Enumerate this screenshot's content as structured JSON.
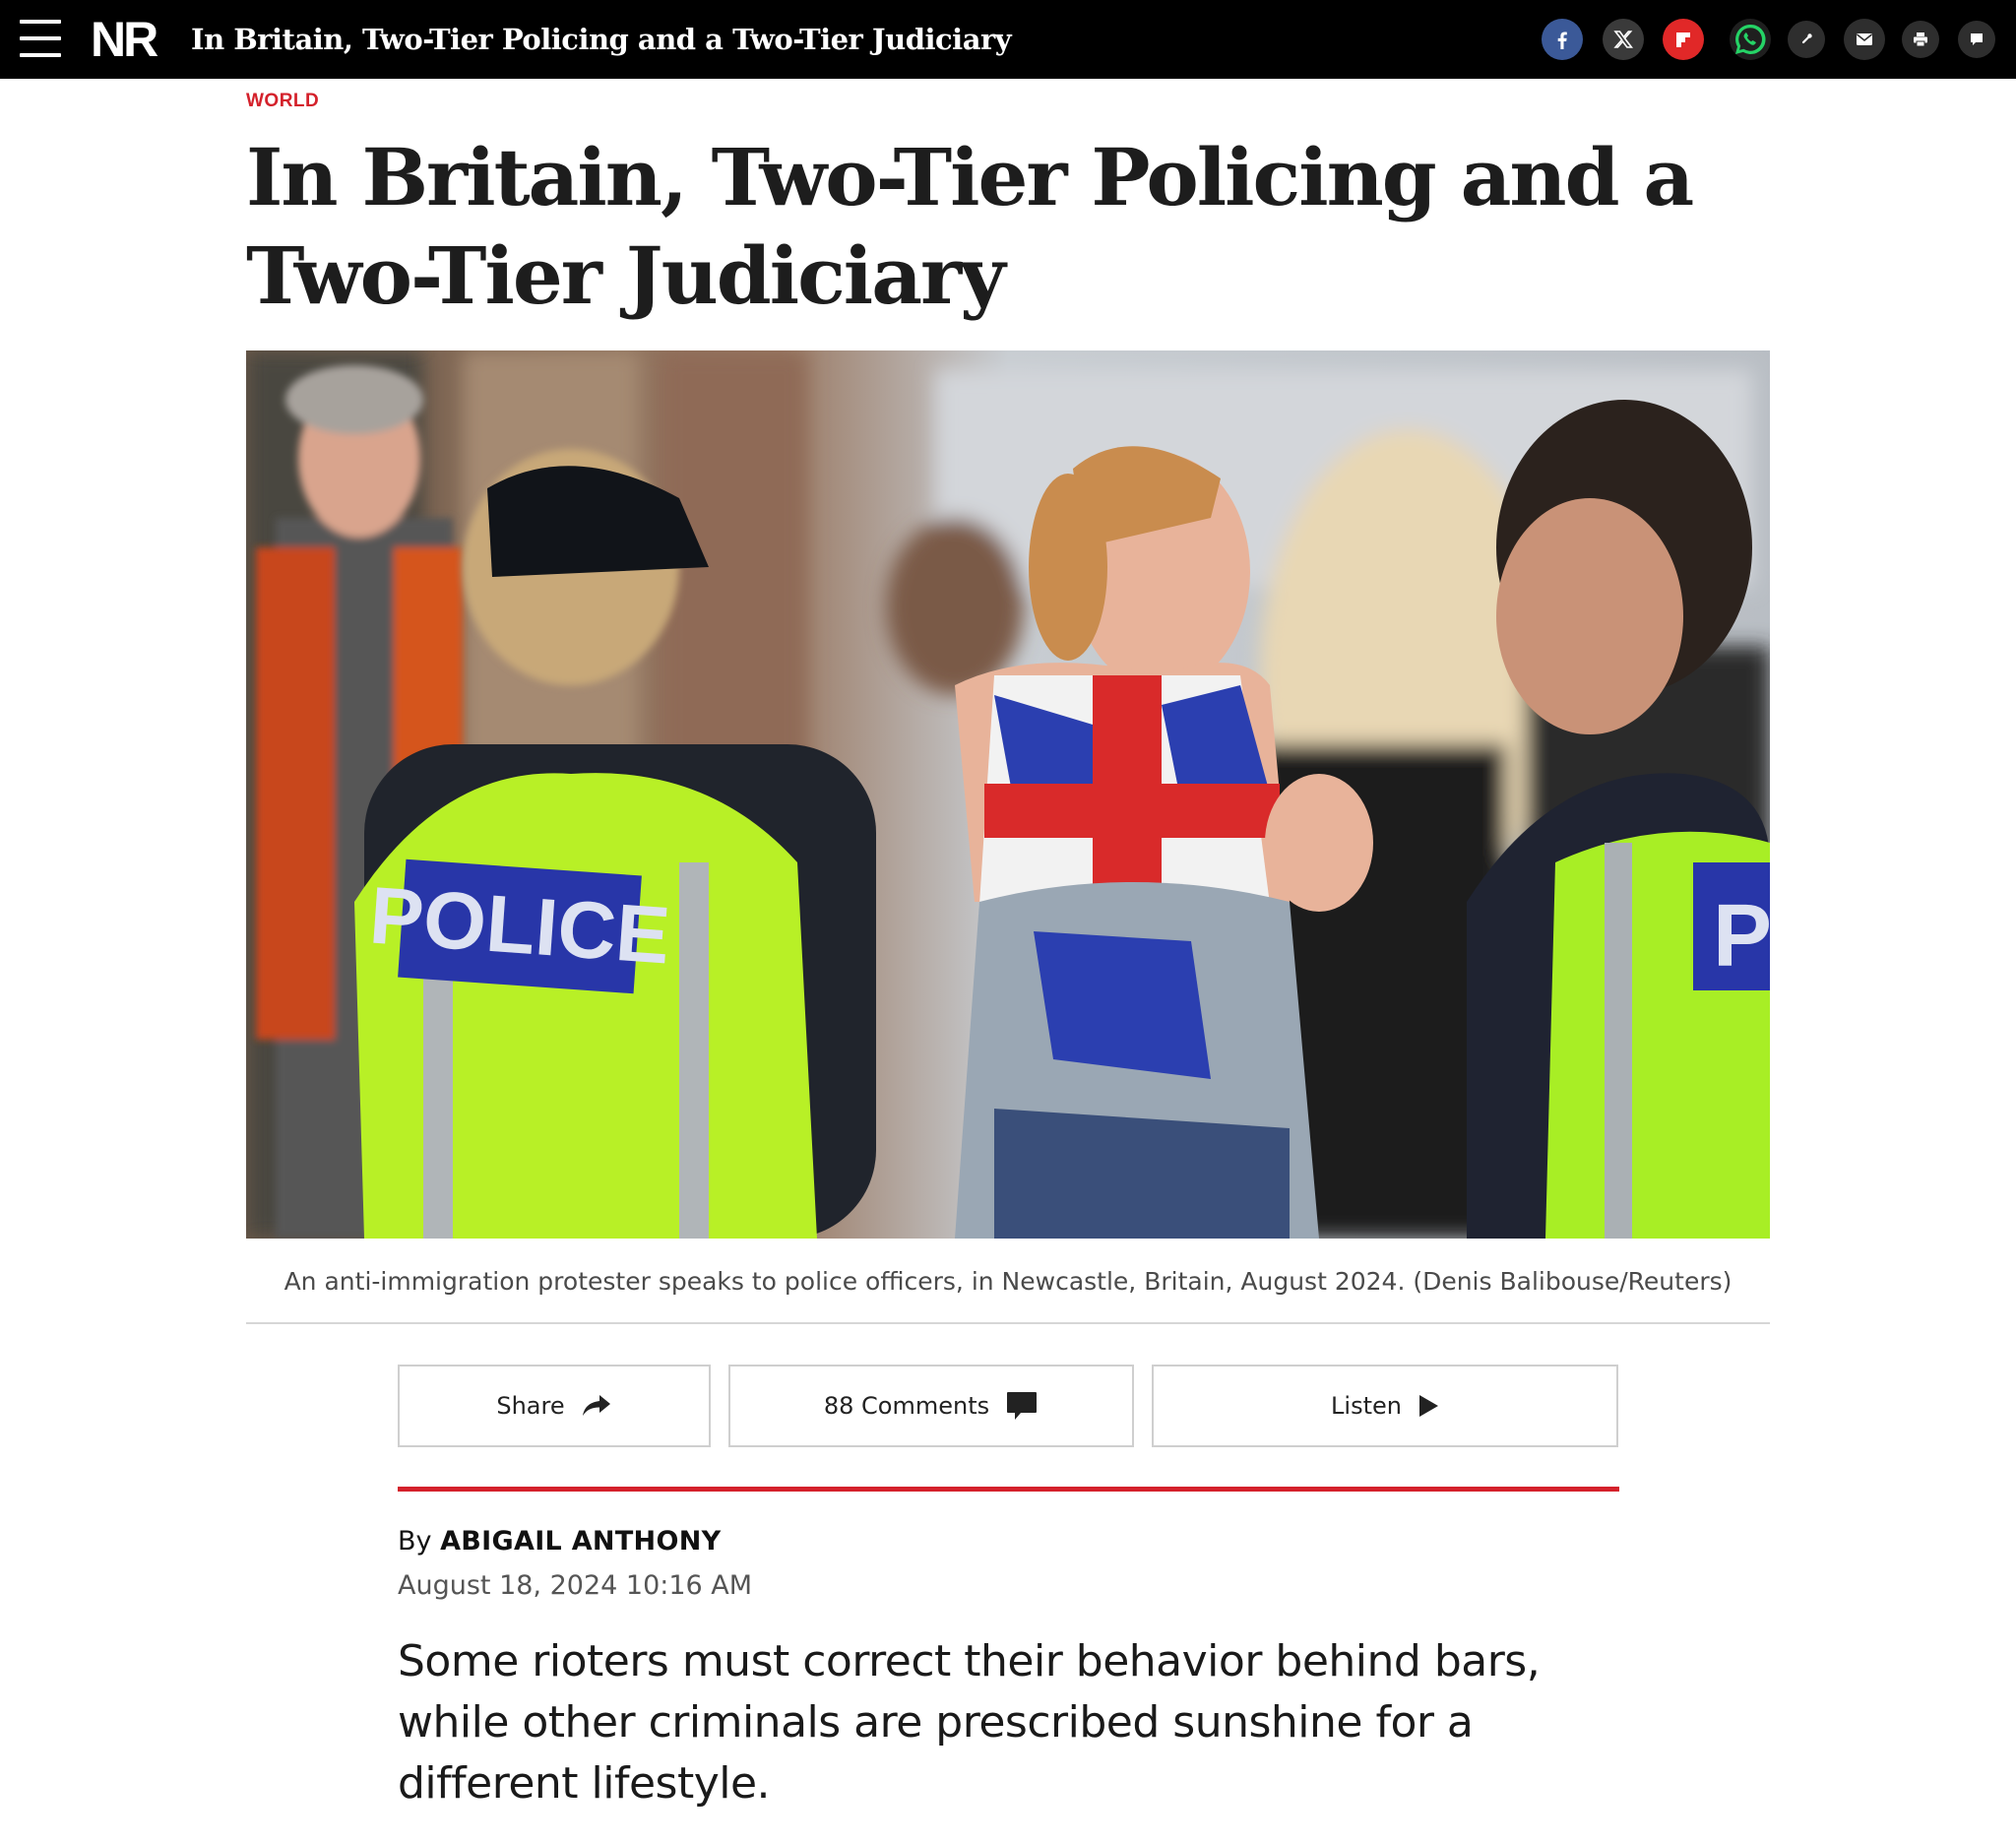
{
  "topbar": {
    "logo": "NR",
    "title": "In Britain, Two-Tier Policing and a Two-Tier Judiciary",
    "share_icons": [
      "facebook-icon",
      "x-icon",
      "flipboard-icon",
      "whatsapp-icon",
      "link-icon",
      "email-icon",
      "print-icon",
      "comment-icon"
    ],
    "colors": {
      "background": "#000000",
      "facebook": "#3b5998",
      "flipboard": "#e12828",
      "whatsapp": "#25d366",
      "accent": "#d4212b"
    }
  },
  "article": {
    "section": "WORLD",
    "headline": "In Britain, Two-Tier Policing and a Two-Tier Judiciary",
    "image_caption": "An anti-immigration protester speaks to police officers, in Newcastle, Britain, August 2024. (Denis Balibouse/Reuters)",
    "actions": {
      "share_label": "Share",
      "comments_label": "88 Comments",
      "listen_label": "Listen"
    },
    "byline_prefix": "By",
    "author": "ABIGAIL ANTHONY",
    "date": "August 18, 2024 10:16 AM",
    "dek": "Some rioters must correct their behavior behind bars, while other criminals are prescribed sunshine for a different lifestyle."
  }
}
